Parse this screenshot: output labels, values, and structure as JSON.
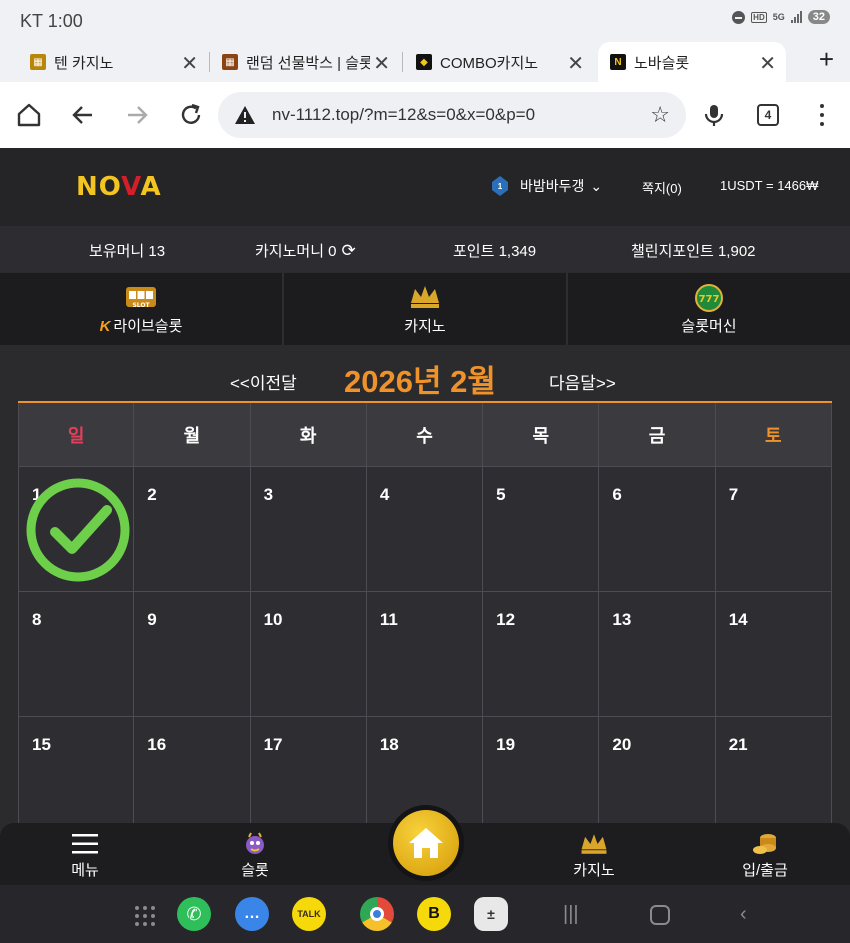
{
  "status_bar": {
    "carrier": "KT",
    "time": "1:00",
    "network": "5G",
    "hd": "HD",
    "battery": "32"
  },
  "browser": {
    "tabs": [
      {
        "title": "텐 카지노",
        "favicon": "slot-favicon"
      },
      {
        "title": "랜덤 선물박스 | 슬롯",
        "favicon": "slot-favicon"
      },
      {
        "title": "COMBO카지노",
        "favicon": "combo-favicon"
      },
      {
        "title": "노바슬롯",
        "favicon": "nova-favicon",
        "active": true
      }
    ],
    "url": "nv-1112.top/?m=12&s=0&x=0&p=0",
    "tab_count": "4"
  },
  "site": {
    "logo": {
      "part1": "NO",
      "part2": "V",
      "part3": "A"
    },
    "user": {
      "level": "1",
      "name": "바밤바두갱"
    },
    "messages": "쪽지(0)",
    "rate": "1USDT = 1466₩",
    "balance": {
      "holding": "보유머니 13",
      "casino": "카지노머니 0",
      "points": "포인트 1,349",
      "challenge": "챌린지포인트 1,902"
    },
    "categories": [
      {
        "label": "라이브슬롯",
        "prefix": "K",
        "icon": "slot-machine-icon",
        "icon_text": "SLOT"
      },
      {
        "label": "카지노",
        "icon": "casino-crown-icon"
      },
      {
        "label": "슬롯머신",
        "icon": "slot-777-icon",
        "icon_text": "777"
      }
    ]
  },
  "calendar": {
    "prev": "<<이전달",
    "next": "다음달>>",
    "title": "2026년 2월",
    "weekdays": [
      "일",
      "월",
      "화",
      "수",
      "목",
      "금",
      "토"
    ],
    "weeks": [
      [
        "1",
        "2",
        "3",
        "4",
        "5",
        "6",
        "7"
      ],
      [
        "8",
        "9",
        "10",
        "11",
        "12",
        "13",
        "14"
      ],
      [
        "15",
        "16",
        "17",
        "18",
        "19",
        "20",
        "21"
      ]
    ],
    "checked_day": "1"
  },
  "bottom_nav": {
    "menu": "메뉴",
    "slot": "슬롯",
    "casino": "카지노",
    "deposit": "입/출금"
  },
  "dock": {
    "apps": [
      "apps-grid-icon",
      "phone-icon",
      "messages-icon",
      "kakaotalk-icon",
      "chrome-icon",
      "band-icon",
      "calculator-icon"
    ],
    "kakaotalk_label": "TALK",
    "band_label": "B"
  },
  "colors": {
    "accent": "#f0922a",
    "sunday": "#e0405a",
    "logo": "#f3c521",
    "check": "#6ed04a"
  }
}
